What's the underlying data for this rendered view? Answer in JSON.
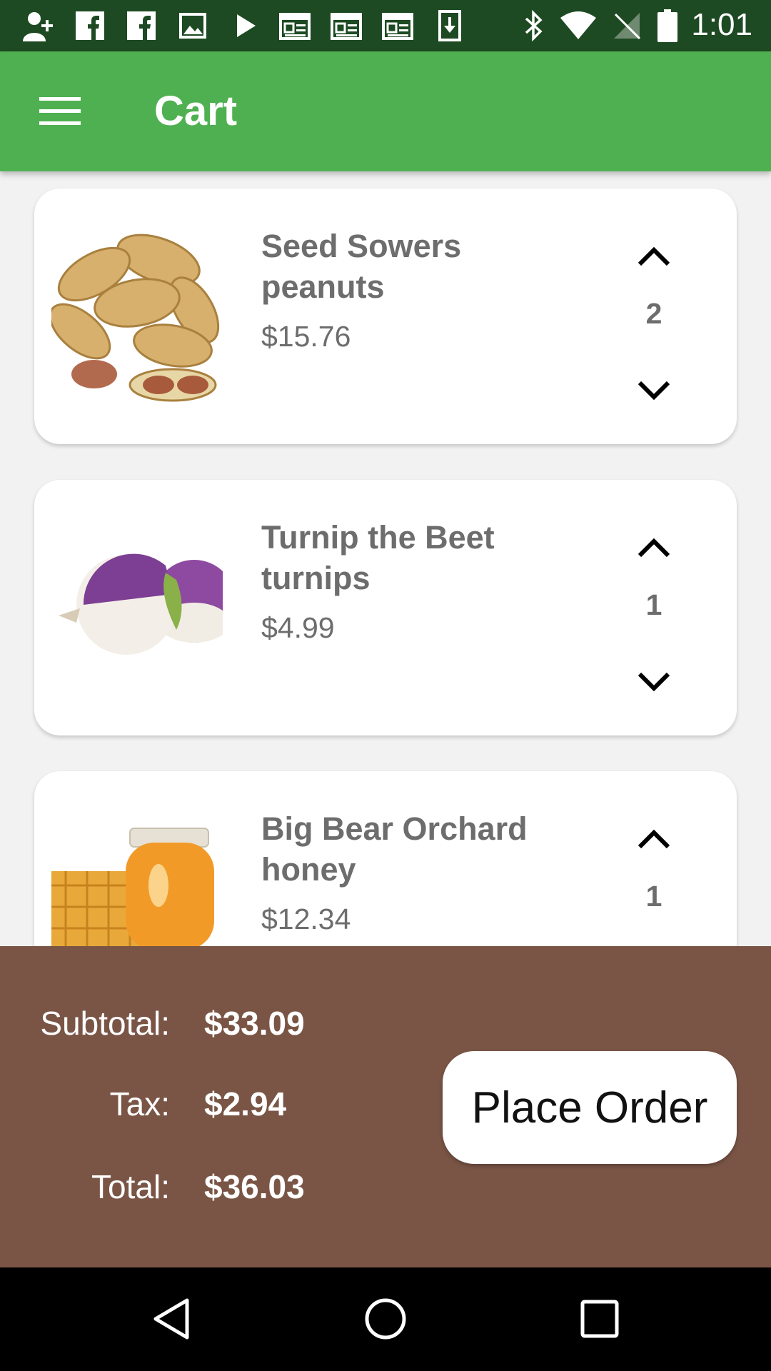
{
  "status_bar": {
    "time": "1:01",
    "left_icons": [
      "add-contact-icon",
      "facebook-icon",
      "facebook-icon",
      "image-icon",
      "play-store-icon",
      "news-icon",
      "news-icon",
      "news-icon",
      "download-icon"
    ],
    "right_icons": [
      "bluetooth-icon",
      "wifi-icon",
      "no-signal-icon",
      "battery-icon"
    ]
  },
  "app_bar": {
    "title": "Cart",
    "menu_icon": "menu-icon",
    "color": "#4fb051"
  },
  "cart": {
    "items": [
      {
        "name": "Seed Sowers peanuts",
        "price": "$15.76",
        "quantity": "2",
        "image": "peanuts"
      },
      {
        "name": "Turnip the Beet turnips",
        "price": "$4.99",
        "quantity": "1",
        "image": "turnips"
      },
      {
        "name": "Big Bear Orchard honey",
        "price": "$12.34",
        "quantity": "1",
        "image": "honey"
      }
    ]
  },
  "summary": {
    "subtotal_label": "Subtotal:",
    "subtotal_value": "$33.09",
    "tax_label": "Tax:",
    "tax_value": "$2.94",
    "total_label": "Total:",
    "total_value": "$36.03",
    "place_order_label": "Place Order",
    "background": "#7a5546"
  },
  "nav_bar": {
    "icons": [
      "back-icon",
      "home-icon",
      "recents-icon"
    ]
  }
}
